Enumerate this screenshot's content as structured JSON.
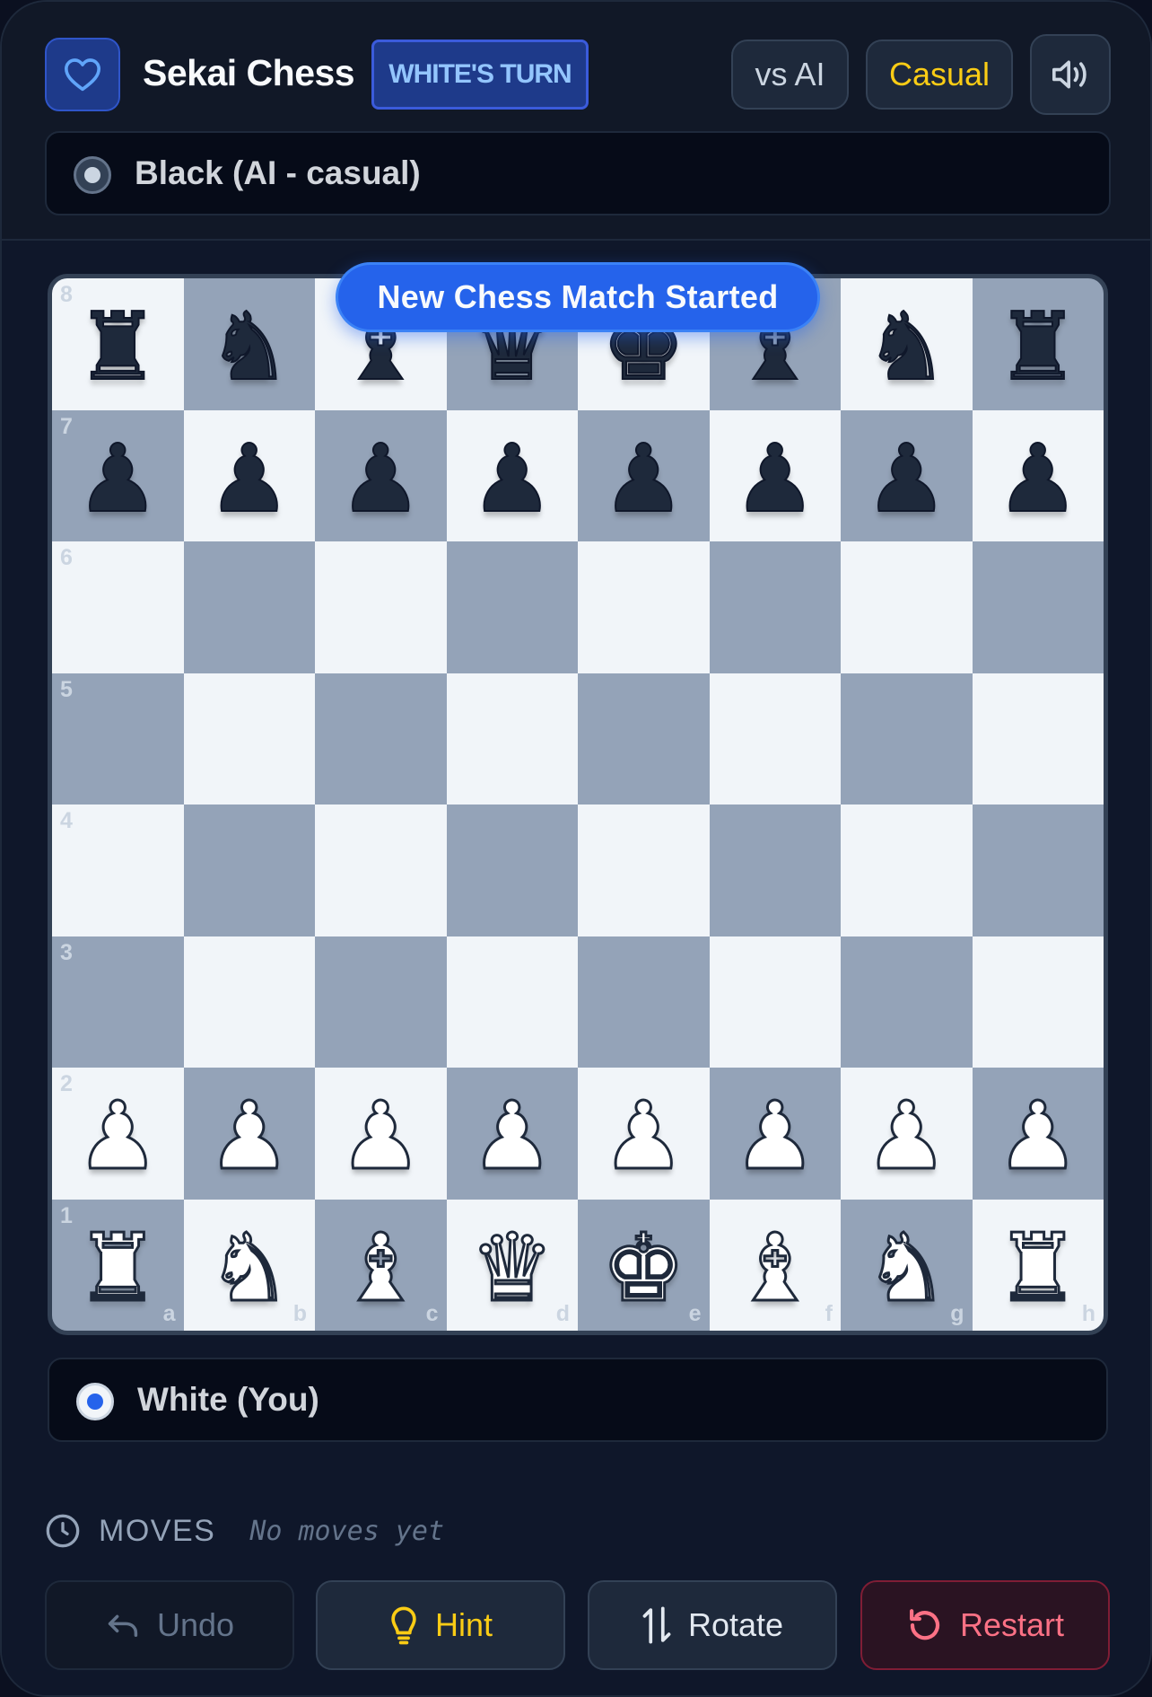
{
  "header": {
    "title": "Sekai Chess",
    "turn_badge": "WHITE'S TURN",
    "mode_label": "vs AI",
    "difficulty_label": "Casual"
  },
  "players": {
    "top": "Black (AI - casual)",
    "bottom": "White (You)"
  },
  "toast": "New Chess Match Started",
  "board": {
    "ranks": [
      "8",
      "7",
      "6",
      "5",
      "4",
      "3",
      "2",
      "1"
    ],
    "files": [
      "a",
      "b",
      "c",
      "d",
      "e",
      "f",
      "g",
      "h"
    ],
    "rows": [
      [
        "bR",
        "bN",
        "bB",
        "bQ",
        "bK",
        "bB",
        "bN",
        "bR"
      ],
      [
        "bP",
        "bP",
        "bP",
        "bP",
        "bP",
        "bP",
        "bP",
        "bP"
      ],
      [
        "",
        "",
        "",
        "",
        "",
        "",
        "",
        ""
      ],
      [
        "",
        "",
        "",
        "",
        "",
        "",
        "",
        ""
      ],
      [
        "",
        "",
        "",
        "",
        "",
        "",
        "",
        ""
      ],
      [
        "",
        "",
        "",
        "",
        "",
        "",
        "",
        ""
      ],
      [
        "wP",
        "wP",
        "wP",
        "wP",
        "wP",
        "wP",
        "wP",
        "wP"
      ],
      [
        "wR",
        "wN",
        "wB",
        "wQ",
        "wK",
        "wB",
        "wN",
        "wR"
      ]
    ]
  },
  "moves": {
    "label": "MOVES",
    "empty_text": "No moves yet"
  },
  "actions": {
    "undo": "Undo",
    "hint": "Hint",
    "rotate": "Rotate",
    "restart": "Restart"
  },
  "icons": {
    "favorite": "heart-icon",
    "sound": "speaker-icon",
    "moves": "clock-icon",
    "undo": "undo-arrow-icon",
    "hint": "lightbulb-icon",
    "rotate": "swap-arrows-icon",
    "restart": "restart-icon"
  },
  "colors": {
    "accent": "#2563eb",
    "board_light": "#f1f5f9",
    "board_dark": "#94a3b8",
    "difficulty": "#facc15",
    "restart": "#fb7185"
  }
}
